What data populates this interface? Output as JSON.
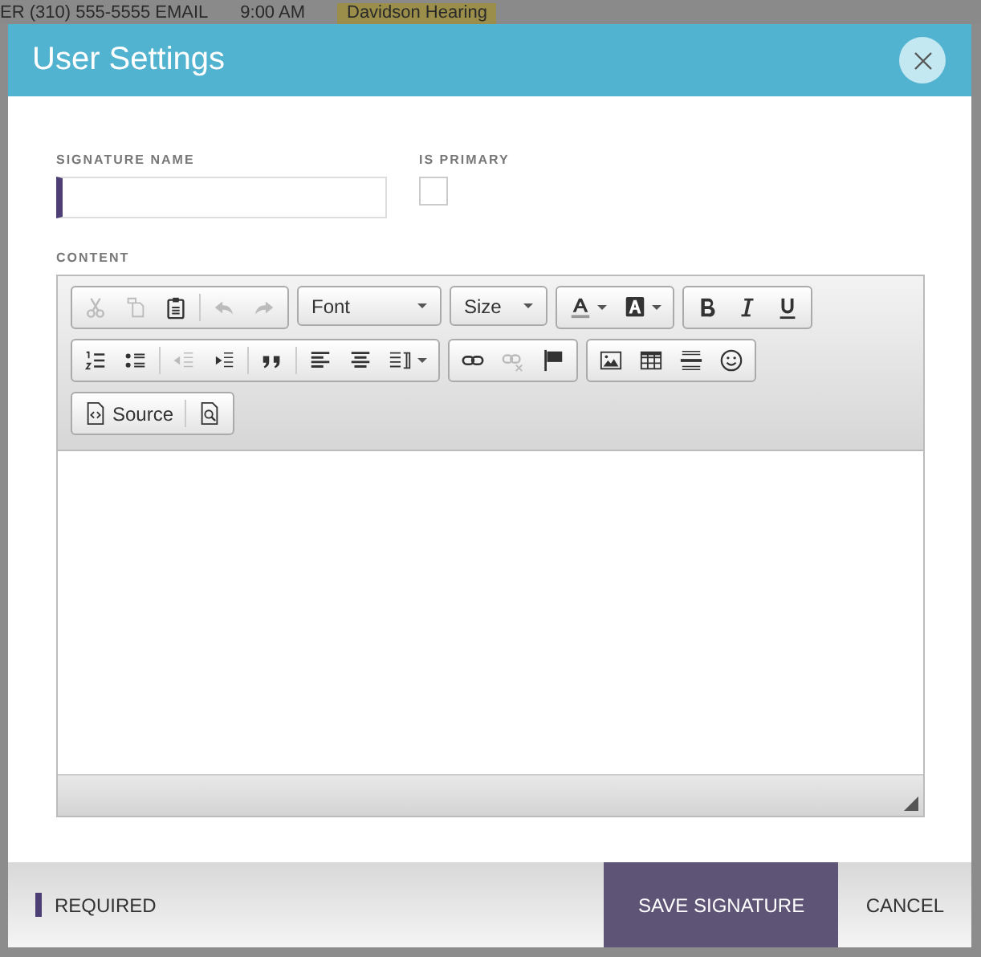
{
  "background": {
    "texts": [
      "ER (310) 555-5555 EMAIL",
      "9:00 AM",
      "Davidson Hearing"
    ]
  },
  "dialog": {
    "title": "User Settings"
  },
  "form": {
    "signature_name": {
      "label": "SIGNATURE NAME",
      "required": true
    },
    "is_primary": {
      "label": "IS PRIMARY",
      "checked": false
    },
    "content": {
      "label": "CONTENT"
    }
  },
  "toolbar": [
    [
      {
        "kind": "group",
        "items": [
          {
            "kind": "cut",
            "disabled": true
          },
          {
            "kind": "copy",
            "disabled": true
          },
          {
            "kind": "paste",
            "disabled": false
          },
          {
            "kind": "separator"
          },
          {
            "kind": "undo",
            "disabled": true
          },
          {
            "kind": "redo",
            "disabled": true
          }
        ]
      },
      {
        "kind": "combo",
        "label": "Font"
      },
      {
        "kind": "combo",
        "label": "Size"
      },
      {
        "kind": "group",
        "items": [
          {
            "kind": "textcolor",
            "disabled": false
          },
          {
            "kind": "bgcolor",
            "disabled": false
          }
        ]
      },
      {
        "kind": "group",
        "items": [
          {
            "kind": "bold",
            "disabled": false
          },
          {
            "kind": "italic",
            "disabled": false
          },
          {
            "kind": "underline",
            "disabled": false
          }
        ]
      }
    ],
    [
      {
        "kind": "group",
        "items": [
          {
            "kind": "numlist",
            "disabled": false
          },
          {
            "kind": "bullist",
            "disabled": false
          },
          {
            "kind": "separator"
          },
          {
            "kind": "outdent",
            "disabled": true
          },
          {
            "kind": "indent",
            "disabled": false
          },
          {
            "kind": "separator"
          },
          {
            "kind": "quote",
            "disabled": false
          },
          {
            "kind": "separator"
          },
          {
            "kind": "alignleft",
            "disabled": false
          },
          {
            "kind": "aligncenter",
            "disabled": false
          },
          {
            "kind": "bidi",
            "disabled": false
          }
        ]
      },
      {
        "kind": "group",
        "items": [
          {
            "kind": "link",
            "disabled": false
          },
          {
            "kind": "unlink",
            "disabled": true
          },
          {
            "kind": "anchor",
            "disabled": false
          }
        ]
      },
      {
        "kind": "group",
        "items": [
          {
            "kind": "image",
            "disabled": false
          },
          {
            "kind": "table",
            "disabled": false
          },
          {
            "kind": "hrule",
            "disabled": false
          },
          {
            "kind": "smiley",
            "disabled": false
          }
        ]
      }
    ],
    [
      {
        "kind": "group",
        "items": [
          {
            "kind": "source",
            "label": "Source",
            "disabled": false
          },
          {
            "kind": "separator"
          },
          {
            "kind": "preview",
            "disabled": false
          }
        ]
      }
    ]
  ],
  "footer": {
    "legend": "REQUIRED",
    "buttons": [
      {
        "label": "SAVE SIGNATURE",
        "kind": "primary"
      },
      {
        "label": "CANCEL",
        "kind": "plain"
      }
    ]
  }
}
